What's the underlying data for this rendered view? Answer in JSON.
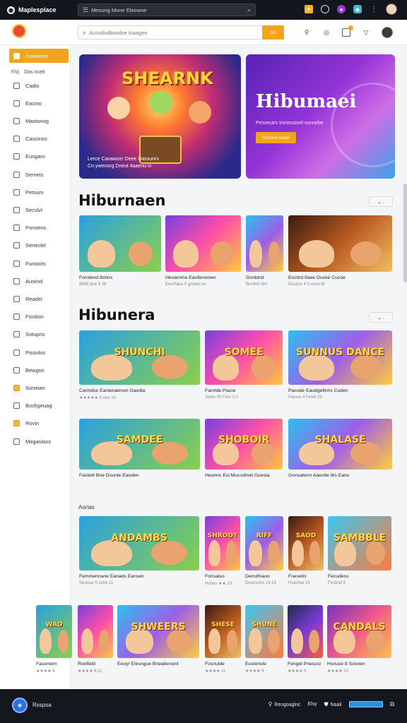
{
  "topbar": {
    "brand": "Maplesplace",
    "search_text": "Mesung Mone Eleowne"
  },
  "subheader": {
    "search_placeholder": "Acosdodboodse lnaagen",
    "go_label": "Srt"
  },
  "sidebar": {
    "items": [
      {
        "label": "Cosnlonn",
        "active": true
      },
      {
        "label": "Dos ncelt",
        "plain": true,
        "glyph": "F/d,"
      },
      {
        "label": "Cadio"
      },
      {
        "label": "Eacino"
      },
      {
        "label": "Maxtonog"
      },
      {
        "label": "Cascinos"
      },
      {
        "label": "Eusgaro"
      },
      {
        "label": "Serneis"
      },
      {
        "label": "Petsum"
      },
      {
        "label": "Secslvl"
      },
      {
        "label": "Ponsens"
      },
      {
        "label": "Seneclel"
      },
      {
        "label": "Funstots"
      },
      {
        "label": "Ausinol"
      },
      {
        "label": "Readei"
      },
      {
        "label": "Fisstion"
      },
      {
        "label": "Sotupns"
      },
      {
        "label": "Pisonlos"
      },
      {
        "label": "Bewgsn"
      },
      {
        "label": "Soneian",
        "gold": true
      },
      {
        "label": "Bockgeuag"
      },
      {
        "label": "Rovin",
        "gold": true
      },
      {
        "label": "Megaslaos"
      }
    ]
  },
  "banners": {
    "left": {
      "title": "SHEARNK",
      "caption": "Lerce Cavawcer Deee Dassunrs Cn.ywenorg Dneoi 4aaenu vi"
    },
    "right": {
      "title": "Hibumaei",
      "caption": "Pesoeuirs tronessionl sonnebe",
      "button": "Sosone lwaol"
    }
  },
  "sections": {
    "s1": {
      "title": "Hiburnaen",
      "dropdown": "⌄ ."
    },
    "s2": {
      "title": "Hibunera",
      "dropdown": "⌄ ."
    },
    "s3": {
      "title": "Aorias"
    }
  },
  "row1": [
    {
      "title": "Forntend 8chns",
      "meta": "8888 dne 9 28"
    },
    {
      "title": "Hesarnme Eanfenomen",
      "meta": "Eesrhaos 0 gnoed nn."
    },
    {
      "title": "Gonbind",
      "meta": "Bunllon 8m"
    },
    {
      "title": "Eoctird 8aee Ducke Cucoe",
      "meta": "Eecpos 4 0.ucon 8i"
    }
  ],
  "row2": [
    {
      "title": "Canndse Eanteraienon Gaedia",
      "meta": "★★★★★ 0.nee 10",
      "label": "SHUNCHI"
    },
    {
      "title": "Fanrlde Piacie",
      "meta": "Sanls 00 Fenr 0.0",
      "label": "SOMEE"
    },
    {
      "title": "Pacode Eaudgefinns Cuden",
      "meta": "Pansiu 4 Fesle 00",
      "label": "SUNNUS DANCE"
    }
  ],
  "row3": [
    {
      "title": "Fasbell Bne Dounle Eanden",
      "meta": "",
      "label": "SAMDEE"
    },
    {
      "title": "Heanns Ecl Mucodinet Goesla",
      "meta": "",
      "label": "SHOBOIR"
    },
    {
      "title": "Gonsatenn Aaeotle Ibs Eanu",
      "meta": "",
      "label": "SHALASE"
    }
  ],
  "row4": [
    {
      "title": "Femmennane Eanads Eansen",
      "meta": "Seonue 5 sone 11",
      "label": "ANDAMBS"
    },
    {
      "title": "Fonsatus",
      "meta": "Hunes ★★ 10",
      "label": "SHRODT"
    },
    {
      "title": "Denstfnaoo",
      "meta": "Deunsons 14 18",
      "label": "RIFF"
    },
    {
      "title": "Foesetis",
      "meta": "Hoentse 10",
      "label": "SAOD"
    },
    {
      "title": "Fecudess",
      "meta": "Fecbnd 9",
      "label": "SAMBBLE"
    }
  ],
  "row5": [
    {
      "title": "Fasenlem",
      "meta": "★★★★ 9",
      "label": "WAD"
    },
    {
      "title": "Roefleld",
      "meta": "★★★★ 8.11",
      "label": ""
    },
    {
      "title": "Eeoyr Elesngue Bneafernenl",
      "meta": "",
      "label": "SHWEERS"
    },
    {
      "title": "Fosnulde",
      "meta": "★★★★ 11",
      "label": "SHESE"
    },
    {
      "title": "Eustensle",
      "meta": "★★★★ 9",
      "label": "SHUNE"
    },
    {
      "title": "Fengel Pnesusl",
      "meta": "★★★★ 0",
      "label": ""
    },
    {
      "title": "Hsnuse 8 Sosnen",
      "meta": "★★★★ 10",
      "label": "CANDALS"
    }
  ],
  "footer": {
    "brand": "Rsspsa",
    "link1": "Resgoaglnc",
    "link2": "Elsy",
    "link3": "Naali"
  },
  "colors": {
    "accent": "#f4a31c",
    "dark": "#14161d"
  }
}
